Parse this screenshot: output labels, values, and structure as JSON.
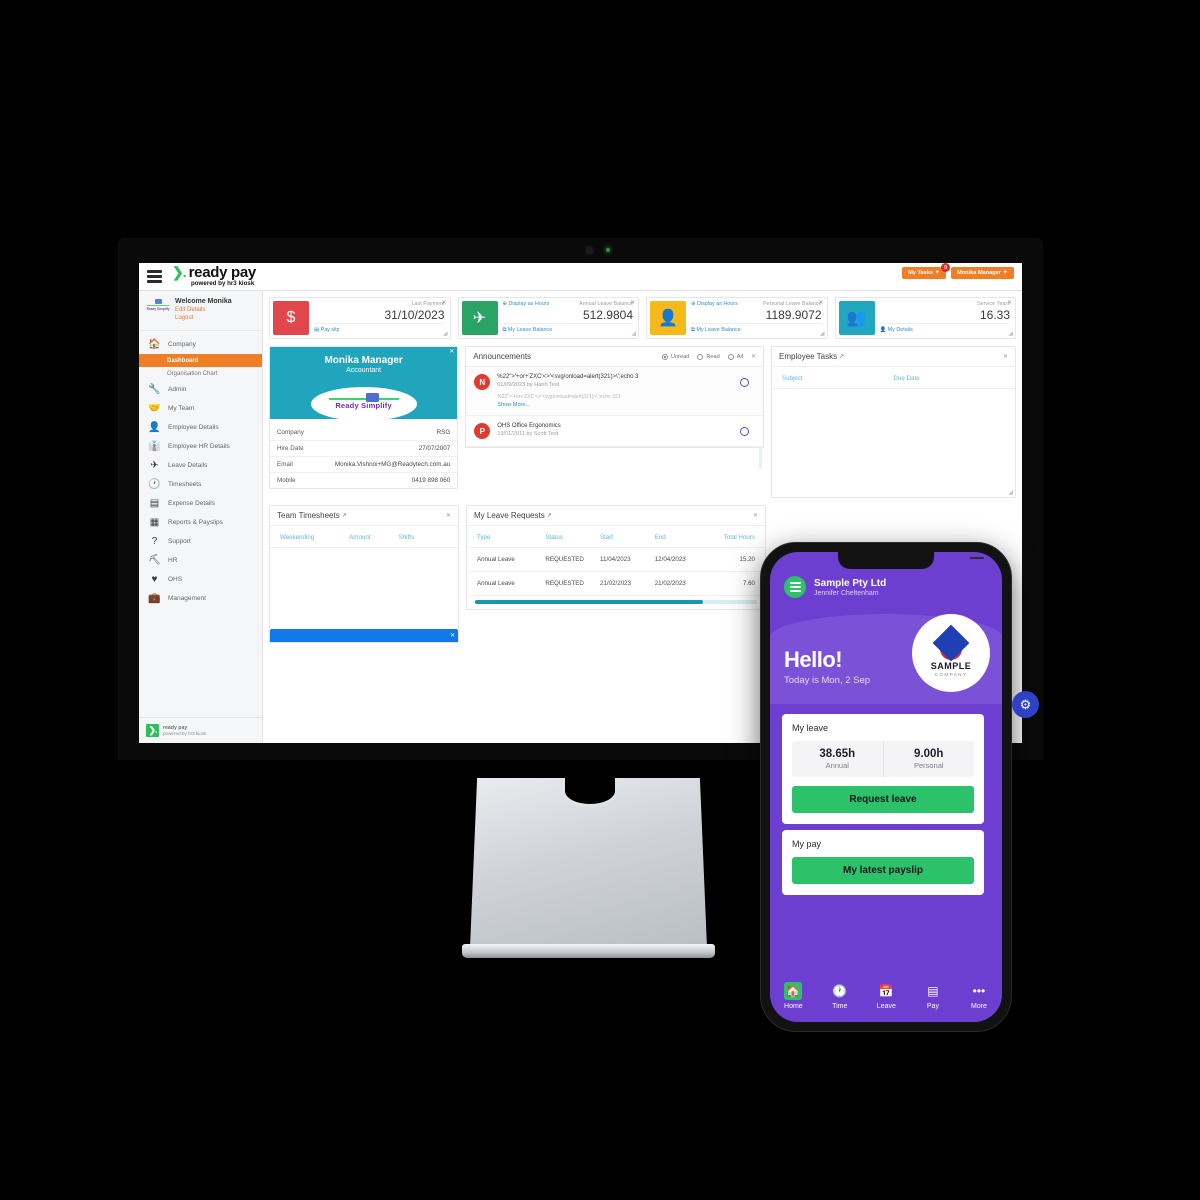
{
  "desktop": {
    "header": {
      "brand_arrow": "❯.",
      "brand_name": "ready pay",
      "brand_sub": "powered by hr3 kiosk",
      "menu_icon": "hamburger-icon",
      "my_tasks_label": "My Tasks ▼",
      "my_tasks_badge": "0",
      "user_menu_label": "Monika Manager ▼"
    },
    "sidebar": {
      "welcome_name": "Welcome Monika",
      "edit_details": "Edit Details",
      "logout": "Logout",
      "logo_text": "Ready Simplify",
      "items": [
        {
          "label": "Company",
          "icon": "home-icon"
        },
        {
          "label": "Dashboard",
          "icon": "",
          "sub": true,
          "active": true
        },
        {
          "label": "Organisation Chart",
          "icon": "",
          "sub": true
        },
        {
          "label": "Admin",
          "icon": "wrench-icon"
        },
        {
          "label": "My Team",
          "icon": "handshake-icon"
        },
        {
          "label": "Employee Details",
          "icon": "user-icon"
        },
        {
          "label": "Employee HR Details",
          "icon": "user-tie-icon"
        },
        {
          "label": "Leave Details",
          "icon": "plane-icon"
        },
        {
          "label": "Timesheets",
          "icon": "clock-icon"
        },
        {
          "label": "Expense Details",
          "icon": "card-icon"
        },
        {
          "label": "Reports & Payslips",
          "icon": "table-icon"
        },
        {
          "label": "Support",
          "icon": "question-icon"
        },
        {
          "label": "HR",
          "icon": "sitemap-icon"
        },
        {
          "label": "OHS",
          "icon": "heart-icon"
        },
        {
          "label": "Management",
          "icon": "briefcase-icon"
        }
      ],
      "footer_line1": "ready pay",
      "footer_line2": "powered by hr3 kiosk"
    },
    "stats": [
      {
        "icon": "dollar-icon",
        "color": "#e0474c",
        "label": "Last Payment",
        "value": "31/10/2023",
        "foot": "Pay slip",
        "foot_icon": "card-icon",
        "hours_link": ""
      },
      {
        "icon": "plane-icon",
        "color": "#2aa367",
        "label": "Annual Leave Balance",
        "value": "512.9804",
        "foot": "My Leave Balance",
        "foot_icon": "copy-icon",
        "hours_link": "Display as Hours"
      },
      {
        "icon": "user-tie-icon",
        "color": "#f5b91b",
        "label": "Personal Leave Balance",
        "value": "1189.9072",
        "foot": "My Leave Balance",
        "foot_icon": "copy-icon",
        "hours_link": "Display as Hours"
      },
      {
        "icon": "users-icon",
        "color": "#21a8c0",
        "label": "Service Years",
        "value": "16.33",
        "foot": "My Details",
        "foot_icon": "user-icon",
        "hours_link": ""
      }
    ],
    "profile": {
      "name": "Monika Manager",
      "role": "Accountant",
      "logo_text": "Ready Simplify",
      "rows": [
        {
          "k": "Company",
          "v": "RSG"
        },
        {
          "k": "Hire Date",
          "v": "27/07/2007"
        },
        {
          "k": "Email",
          "v": "Monika.Vishnoi+MG@Readytech.com.au"
        },
        {
          "k": "Mobile",
          "v": "0419 898 060"
        }
      ]
    },
    "announcements": {
      "title": "Announcements",
      "filters": [
        {
          "label": "Unread",
          "selected": true
        },
        {
          "label": "Read",
          "selected": false
        },
        {
          "label": "All",
          "selected": false
        }
      ],
      "items": [
        {
          "avatar": "N",
          "title": "%22\">'+or+'ZXC'<>'<svg/onload=alert(321)>\\';echo 3",
          "meta": "01/09/2023 by Hanh Test",
          "body": "%22\">'+or+'ZXC'<>'<svg/onload=alert(321)>\\';echo 321",
          "more": "Show More..."
        },
        {
          "avatar": "P",
          "title": "OHS Office Ergonomics",
          "meta": "19/01/2011 by Scott Test",
          "body": "",
          "more": ""
        }
      ]
    },
    "tasks": {
      "title": "Employee Tasks",
      "columns": [
        "Subject",
        "Due Date"
      ],
      "rows": []
    },
    "timesheets": {
      "title": "Team Timesheets",
      "columns": [
        "Weekending",
        "Amount",
        "Shifts"
      ],
      "rows": []
    },
    "leave_requests": {
      "title": "My Leave Requests",
      "columns": [
        "Type",
        "Status",
        "Start",
        "End",
        "Total Hours"
      ],
      "rows": [
        [
          "Annual Leave",
          "REQUESTED",
          "11/04/2023",
          "12/04/2023",
          "15.20"
        ],
        [
          "Annual Leave",
          "REQUESTED",
          "21/02/2023",
          "21/02/2023",
          "7.60"
        ]
      ]
    }
  },
  "phone": {
    "company": "Sample Pty Ltd",
    "user": "Jennifer Cheltenham",
    "greeting": "Hello!",
    "today": "Today is Mon, 2 Sep",
    "badge_name": "SAMPLE",
    "badge_sub": "COMPANY",
    "leave_section": "My leave",
    "leave_stats": [
      {
        "value": "38.65h",
        "label": "Annual"
      },
      {
        "value": "9.00h",
        "label": "Personal"
      }
    ],
    "request_leave": "Request leave",
    "pay_section": "My pay",
    "latest_payslip": "My latest payslip",
    "nav": [
      {
        "label": "Home",
        "icon": "home-icon",
        "active": true
      },
      {
        "label": "Time",
        "icon": "clock-icon",
        "active": false
      },
      {
        "label": "Leave",
        "icon": "calendar-icon",
        "active": false
      },
      {
        "label": "Pay",
        "icon": "wallet-icon",
        "active": false
      },
      {
        "label": "More",
        "icon": "ellipsis-icon",
        "active": false
      }
    ]
  },
  "colors": {
    "orange": "#f07e26",
    "green": "#2cc26a",
    "purple": "#6c3fd0",
    "teal": "#20a5bd",
    "blue": "#1178e8"
  }
}
